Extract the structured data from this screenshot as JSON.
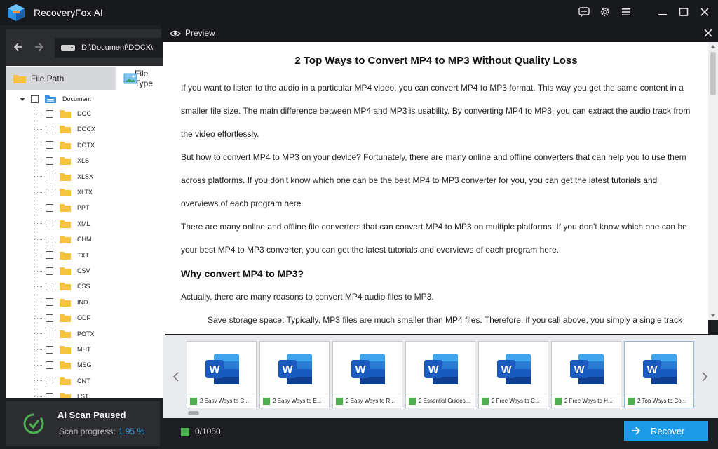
{
  "app": {
    "title": "RecoveryFox AI"
  },
  "nav": {
    "path": "D:\\Document\\DOCX\\"
  },
  "tabs": {
    "file_path": "File Path",
    "file_type": "File Type"
  },
  "tree": {
    "root": "Document",
    "items": [
      "DOC",
      "DOCX",
      "DOTX",
      "XLS",
      "XLSX",
      "XLTX",
      "PPT",
      "XML",
      "CHM",
      "TXT",
      "CSV",
      "CSS",
      "IND",
      "ODF",
      "POTX",
      "MHT",
      "MSG",
      "CNT",
      "LST"
    ]
  },
  "scan": {
    "title": "AI Scan Paused",
    "progress_label": "Scan progress:",
    "progress_value": "1.95 %"
  },
  "preview": {
    "label": "Preview",
    "title": "2 Top Ways to Convert MP4 to MP3 Without Quality Loss",
    "p1": "If you want to listen to the audio in a particular MP4 video, you can convert MP4 to MP3 format. This way you get the same content in a smaller file size. The main difference between MP4 and MP3 is usability. By converting MP4 to MP3, you can extract the audio track from the video effortlessly.",
    "p2": "But how to convert MP4 to MP3 on your device? Fortunately, there are many online and offline converters that can help you to use them across platforms. If you don't know which one can be the best MP4 to MP3 converter for you, you can get the latest tutorials and overviews of each program here.",
    "p3": "There are many online and offline file converters that can convert MP4 to MP3 on multiple platforms. If you don't know which one can be your best MP4 to MP3 converter, you can get the latest tutorials and overviews of each program here.",
    "h2": "Why convert MP4 to MP3?",
    "p4": "Actually, there are many reasons to convert MP4 audio files to MP3.",
    "p5": "Save storage space: Typically, MP3 files are much smaller than MP4 files. Therefore, if you call above, you simply a single track of"
  },
  "thumbnails": [
    "2 Easy Ways to C...",
    "2 Easy Ways to E...",
    "2 Easy Ways to R...",
    "2 Essential Guides...",
    "2 Free Ways to C...",
    "2 Free Ways to H...",
    "2 Top Ways to Co..."
  ],
  "bottom": {
    "count": "0/1050",
    "recover_label": "Recover"
  },
  "colors": {
    "accent": "#1e9be8",
    "progress": "#2fa3e6",
    "checked": "#4caf50",
    "folder": "#f5c242"
  }
}
